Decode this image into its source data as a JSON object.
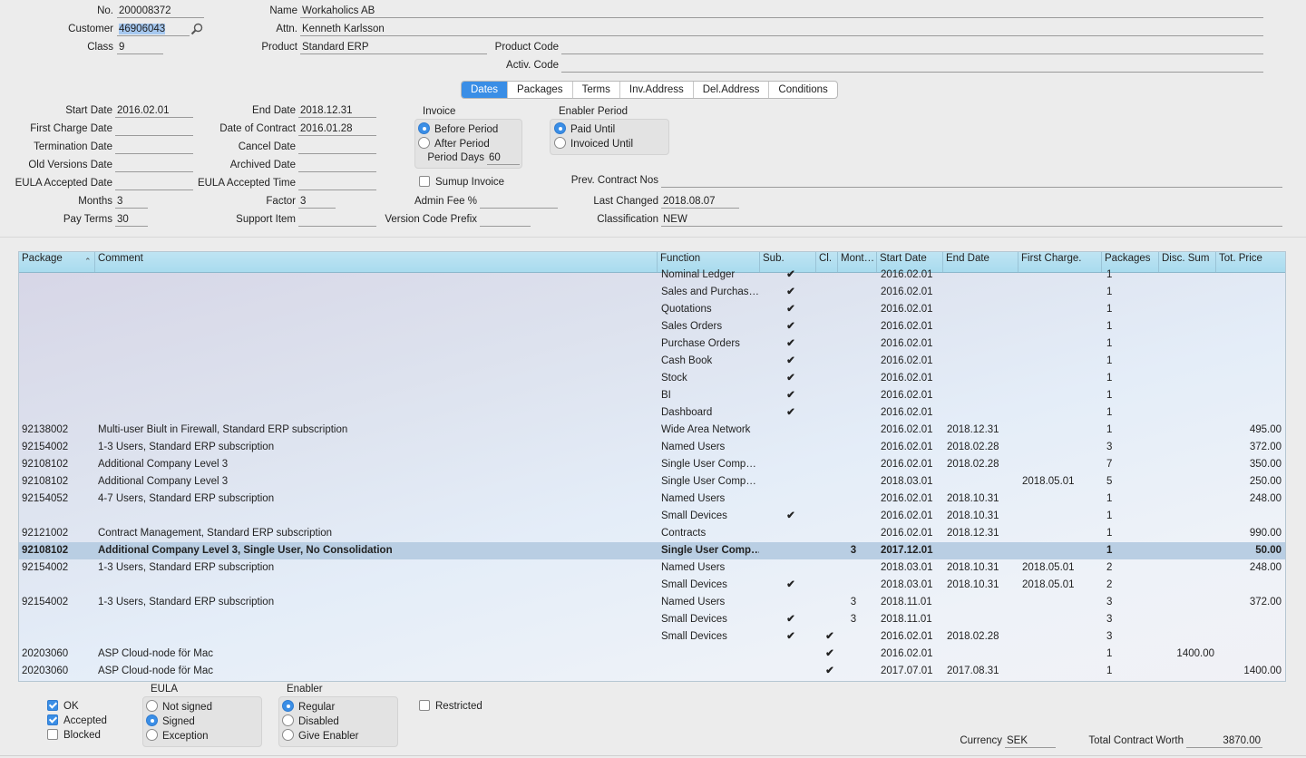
{
  "header": {
    "no": {
      "label": "No.",
      "value": "200008372"
    },
    "customer": {
      "label": "Customer",
      "value": "46906043"
    },
    "class": {
      "label": "Class",
      "value": "9"
    },
    "name": {
      "label": "Name",
      "value": "Workaholics AB"
    },
    "attn": {
      "label": "Attn.",
      "value": "Kenneth Karlsson"
    },
    "product": {
      "label": "Product",
      "value": "Standard ERP"
    },
    "product_code": {
      "label": "Product Code",
      "value": ""
    },
    "activ_code": {
      "label": "Activ. Code",
      "value": ""
    }
  },
  "tabs": [
    {
      "label": "Dates",
      "active": true
    },
    {
      "label": "Packages",
      "active": false
    },
    {
      "label": "Terms",
      "active": false
    },
    {
      "label": "Inv.Address",
      "active": false
    },
    {
      "label": "Del.Address",
      "active": false
    },
    {
      "label": "Conditions",
      "active": false
    }
  ],
  "dates": {
    "start_date": {
      "label": "Start Date",
      "value": "2016.02.01"
    },
    "first_charge_date": {
      "label": "First Charge Date",
      "value": ""
    },
    "termination_date": {
      "label": "Termination Date",
      "value": ""
    },
    "old_versions_date": {
      "label": "Old Versions Date",
      "value": ""
    },
    "eula_accepted_date": {
      "label": "EULA Accepted Date",
      "value": ""
    },
    "months": {
      "label": "Months",
      "value": "3"
    },
    "pay_terms": {
      "label": "Pay Terms",
      "value": "30"
    },
    "end_date": {
      "label": "End Date",
      "value": "2018.12.31"
    },
    "date_of_contract": {
      "label": "Date of Contract",
      "value": "2016.01.28"
    },
    "cancel_date": {
      "label": "Cancel Date",
      "value": ""
    },
    "archived_date": {
      "label": "Archived Date",
      "value": ""
    },
    "eula_accepted_time": {
      "label": "EULA Accepted Time",
      "value": ""
    },
    "factor": {
      "label": "Factor",
      "value": "3"
    },
    "support_item": {
      "label": "Support Item",
      "value": ""
    },
    "invoice": {
      "title": "Invoice",
      "options": [
        {
          "label": "Before Period",
          "selected": true
        },
        {
          "label": "After Period",
          "selected": false
        }
      ],
      "period_days": {
        "label": "Period Days",
        "value": "60"
      }
    },
    "sumup_invoice": {
      "label": "Sumup Invoice",
      "checked": false
    },
    "admin_fee": {
      "label": "Admin Fee %",
      "value": ""
    },
    "version_code_prefix": {
      "label": "Version Code Prefix",
      "value": ""
    },
    "enabler_period": {
      "title": "Enabler Period",
      "options": [
        {
          "label": "Paid Until",
          "selected": true
        },
        {
          "label": "Invoiced Until",
          "selected": false
        }
      ]
    },
    "prev_contract_nos": {
      "label": "Prev. Contract Nos",
      "value": ""
    },
    "last_changed": {
      "label": "Last Changed",
      "value": "2018.08.07"
    },
    "classification": {
      "label": "Classification",
      "value": "NEW"
    }
  },
  "grid": {
    "columns": [
      "Package",
      "Comment",
      "Function",
      "Sub.",
      "Cl.",
      "Mont…",
      "Start Date",
      "End Date",
      "First Charge.",
      "Packages",
      "Disc. Sum",
      "Tot. Price"
    ],
    "rows": [
      {
        "pkg": "",
        "comment": "",
        "function": "Nominal Ledger",
        "sub": "✔",
        "cl": "",
        "months": "",
        "start": "2016.02.01",
        "end": "",
        "first": "",
        "packages": "1",
        "disc": "",
        "total": ""
      },
      {
        "pkg": "",
        "comment": "",
        "function": "Sales and Purchas…",
        "sub": "✔",
        "cl": "",
        "months": "",
        "start": "2016.02.01",
        "end": "",
        "first": "",
        "packages": "1",
        "disc": "",
        "total": ""
      },
      {
        "pkg": "",
        "comment": "",
        "function": "Quotations",
        "sub": "✔",
        "cl": "",
        "months": "",
        "start": "2016.02.01",
        "end": "",
        "first": "",
        "packages": "1",
        "disc": "",
        "total": ""
      },
      {
        "pkg": "",
        "comment": "",
        "function": "Sales Orders",
        "sub": "✔",
        "cl": "",
        "months": "",
        "start": "2016.02.01",
        "end": "",
        "first": "",
        "packages": "1",
        "disc": "",
        "total": ""
      },
      {
        "pkg": "",
        "comment": "",
        "function": "Purchase Orders",
        "sub": "✔",
        "cl": "",
        "months": "",
        "start": "2016.02.01",
        "end": "",
        "first": "",
        "packages": "1",
        "disc": "",
        "total": ""
      },
      {
        "pkg": "",
        "comment": "",
        "function": "Cash Book",
        "sub": "✔",
        "cl": "",
        "months": "",
        "start": "2016.02.01",
        "end": "",
        "first": "",
        "packages": "1",
        "disc": "",
        "total": ""
      },
      {
        "pkg": "",
        "comment": "",
        "function": "Stock",
        "sub": "✔",
        "cl": "",
        "months": "",
        "start": "2016.02.01",
        "end": "",
        "first": "",
        "packages": "1",
        "disc": "",
        "total": ""
      },
      {
        "pkg": "",
        "comment": "",
        "function": "BI",
        "sub": "✔",
        "cl": "",
        "months": "",
        "start": "2016.02.01",
        "end": "",
        "first": "",
        "packages": "1",
        "disc": "",
        "total": ""
      },
      {
        "pkg": "",
        "comment": "",
        "function": "Dashboard",
        "sub": "✔",
        "cl": "",
        "months": "",
        "start": "2016.02.01",
        "end": "",
        "first": "",
        "packages": "1",
        "disc": "",
        "total": ""
      },
      {
        "pkg": "92138002",
        "comment": "Multi-user Biult in Firewall, Standard ERP subscription",
        "function": "Wide Area Network",
        "sub": "",
        "cl": "",
        "months": "",
        "start": "2016.02.01",
        "end": "2018.12.31",
        "first": "",
        "packages": "1",
        "disc": "",
        "total": "495.00"
      },
      {
        "pkg": "92154002",
        "comment": "1-3 Users, Standard ERP subscription",
        "function": "Named Users",
        "sub": "",
        "cl": "",
        "months": "",
        "start": "2016.02.01",
        "end": "2018.02.28",
        "first": "",
        "packages": "3",
        "disc": "",
        "total": "372.00"
      },
      {
        "pkg": "92108102",
        "comment": "Additional Company Level 3",
        "function": "Single User Comp…",
        "sub": "",
        "cl": "",
        "months": "",
        "start": "2016.02.01",
        "end": "2018.02.28",
        "first": "",
        "packages": "7",
        "disc": "",
        "total": "350.00"
      },
      {
        "pkg": "92108102",
        "comment": "Additional Company Level 3",
        "function": "Single User Comp…",
        "sub": "",
        "cl": "",
        "months": "",
        "start": "2018.03.01",
        "end": "",
        "first": "2018.05.01",
        "packages": "5",
        "disc": "",
        "total": "250.00"
      },
      {
        "pkg": "92154052",
        "comment": "4-7 Users, Standard ERP subscription",
        "function": "Named Users",
        "sub": "",
        "cl": "",
        "months": "",
        "start": "2016.02.01",
        "end": "2018.10.31",
        "first": "",
        "packages": "1",
        "disc": "",
        "total": "248.00"
      },
      {
        "pkg": "",
        "comment": "",
        "function": "Small Devices",
        "sub": "✔",
        "cl": "",
        "months": "",
        "start": "2016.02.01",
        "end": "2018.10.31",
        "first": "",
        "packages": "1",
        "disc": "",
        "total": ""
      },
      {
        "pkg": "92121002",
        "comment": "Contract Management, Standard ERP subscription",
        "function": "Contracts",
        "sub": "",
        "cl": "",
        "months": "",
        "start": "2016.02.01",
        "end": "2018.12.31",
        "first": "",
        "packages": "1",
        "disc": "",
        "total": "990.00"
      },
      {
        "pkg": "92108102",
        "comment": "Additional Company Level 3, Single User, No Consolidation",
        "function": "Single User Comp…",
        "sub": "",
        "cl": "",
        "months": "3",
        "start": "2017.12.01",
        "end": "",
        "first": "",
        "packages": "1",
        "disc": "",
        "total": "50.00",
        "selected": true
      },
      {
        "pkg": "92154002",
        "comment": "1-3 Users, Standard ERP subscription",
        "function": "Named Users",
        "sub": "",
        "cl": "",
        "months": "",
        "start": "2018.03.01",
        "end": "2018.10.31",
        "first": "2018.05.01",
        "packages": "2",
        "disc": "",
        "total": "248.00"
      },
      {
        "pkg": "",
        "comment": "",
        "function": "Small Devices",
        "sub": "✔",
        "cl": "",
        "months": "",
        "start": "2018.03.01",
        "end": "2018.10.31",
        "first": "2018.05.01",
        "packages": "2",
        "disc": "",
        "total": ""
      },
      {
        "pkg": "92154002",
        "comment": "1-3 Users, Standard ERP subscription",
        "function": "Named Users",
        "sub": "",
        "cl": "",
        "months": "3",
        "start": "2018.11.01",
        "end": "",
        "first": "",
        "packages": "3",
        "disc": "",
        "total": "372.00"
      },
      {
        "pkg": "",
        "comment": "",
        "function": "Small Devices",
        "sub": "✔",
        "cl": "",
        "months": "3",
        "start": "2018.11.01",
        "end": "",
        "first": "",
        "packages": "3",
        "disc": "",
        "total": ""
      },
      {
        "pkg": "",
        "comment": "",
        "function": "Small Devices",
        "sub": "✔",
        "cl": "✔",
        "months": "",
        "start": "2016.02.01",
        "end": "2018.02.28",
        "first": "",
        "packages": "3",
        "disc": "",
        "total": ""
      },
      {
        "pkg": "20203060",
        "comment": "ASP Cloud-node för Mac",
        "function": "",
        "sub": "",
        "cl": "✔",
        "months": "",
        "start": "2016.02.01",
        "end": "",
        "first": "",
        "packages": "1",
        "disc": "1400.00",
        "total": ""
      },
      {
        "pkg": "20203060",
        "comment": "ASP Cloud-node för Mac",
        "function": "",
        "sub": "",
        "cl": "✔",
        "months": "",
        "start": "2017.07.01",
        "end": "2017.08.31",
        "first": "",
        "packages": "1",
        "disc": "",
        "total": "1400.00"
      }
    ]
  },
  "footer": {
    "ok": {
      "label": "OK",
      "checked": true
    },
    "accepted": {
      "label": "Accepted",
      "checked": true
    },
    "blocked": {
      "label": "Blocked",
      "checked": false
    },
    "eula": {
      "title": "EULA",
      "options": [
        {
          "label": "Not signed",
          "selected": false
        },
        {
          "label": "Signed",
          "selected": true
        },
        {
          "label": "Exception",
          "selected": false
        }
      ]
    },
    "enabler": {
      "title": "Enabler",
      "options": [
        {
          "label": "Regular",
          "selected": true
        },
        {
          "label": "Disabled",
          "selected": false
        },
        {
          "label": "Give Enabler",
          "selected": false
        }
      ]
    },
    "restricted": {
      "label": "Restricted",
      "checked": false
    },
    "currency": {
      "label": "Currency",
      "value": "SEK"
    },
    "total_contract_worth": {
      "label": "Total Contract Worth",
      "value": "3870.00"
    }
  },
  "colors": {
    "accent": "#3a8ee6",
    "grid_header": "#a9dbee",
    "selected_row": "#b9cee3"
  }
}
